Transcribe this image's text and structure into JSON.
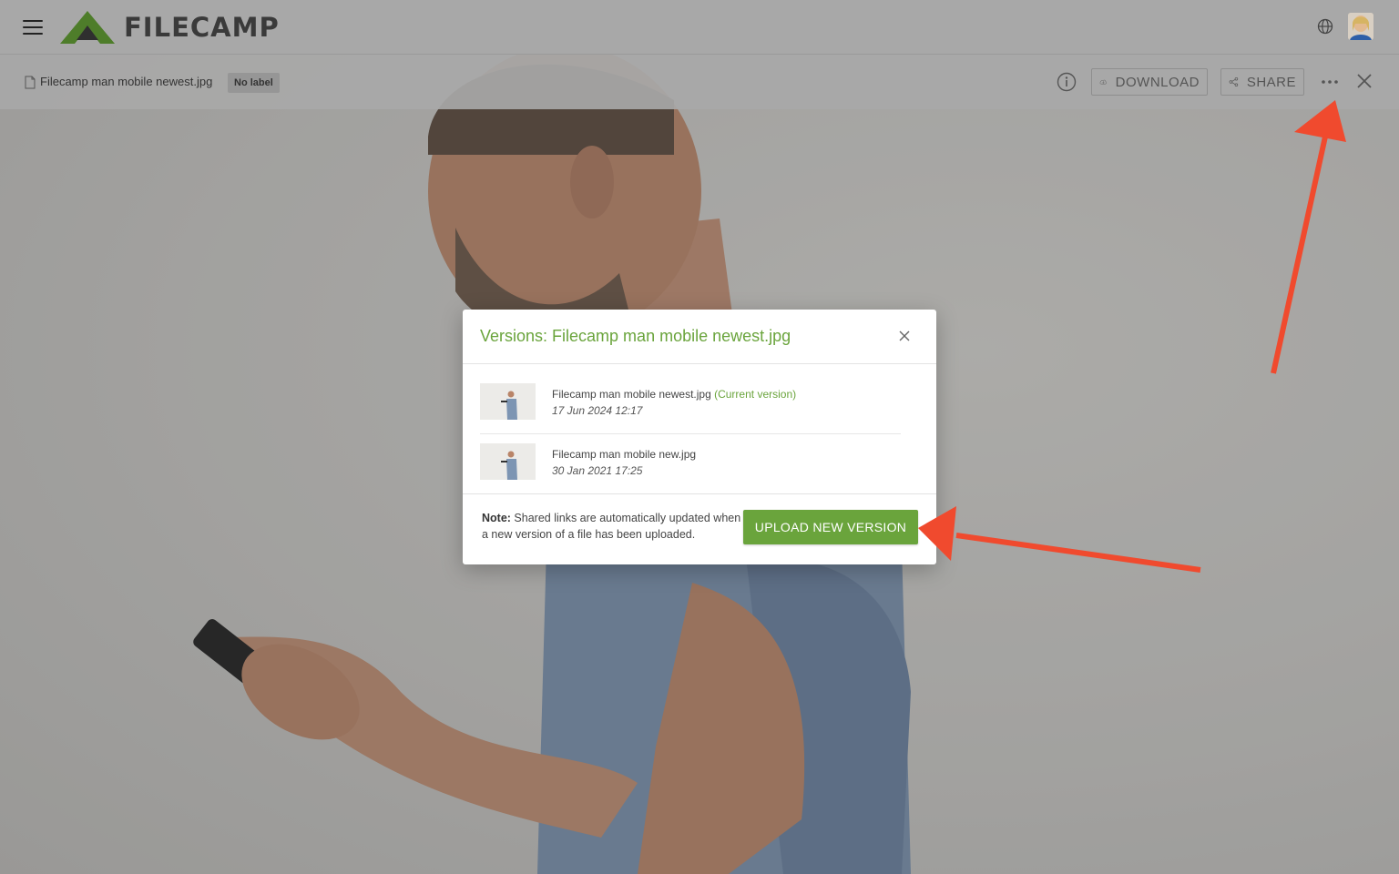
{
  "app": {
    "logo_text": "FILECAMP",
    "menu_icon": "hamburger-menu-icon",
    "language_icon": "globe-icon",
    "avatar_icon": "user-avatar"
  },
  "file_toolbar": {
    "file_icon": "document-icon",
    "file_name": "Filecamp man mobile newest.jpg",
    "label_badge": "No label",
    "info_icon": "info-icon",
    "download_label": "DOWNLOAD",
    "share_label": "SHARE",
    "more_icon": "more-options-icon",
    "close_icon": "close-icon"
  },
  "modal": {
    "title": "Versions: Filecamp man mobile newest.jpg",
    "versions": [
      {
        "name": "Filecamp man mobile newest.jpg",
        "tag": "(Current version)",
        "date": "17 Jun 2024 12:17"
      },
      {
        "name": "Filecamp man mobile new.jpg",
        "tag": "",
        "date": "30 Jan 2021 17:25"
      }
    ],
    "note_label": "Note:",
    "note_text": " Shared links are automatically updated when a new version of a file has been uploaded.",
    "upload_label": "UPLOAD NEW VERSION"
  },
  "colors": {
    "accent_green": "#6aa43c",
    "annotation_arrow": "#f04a2e"
  }
}
